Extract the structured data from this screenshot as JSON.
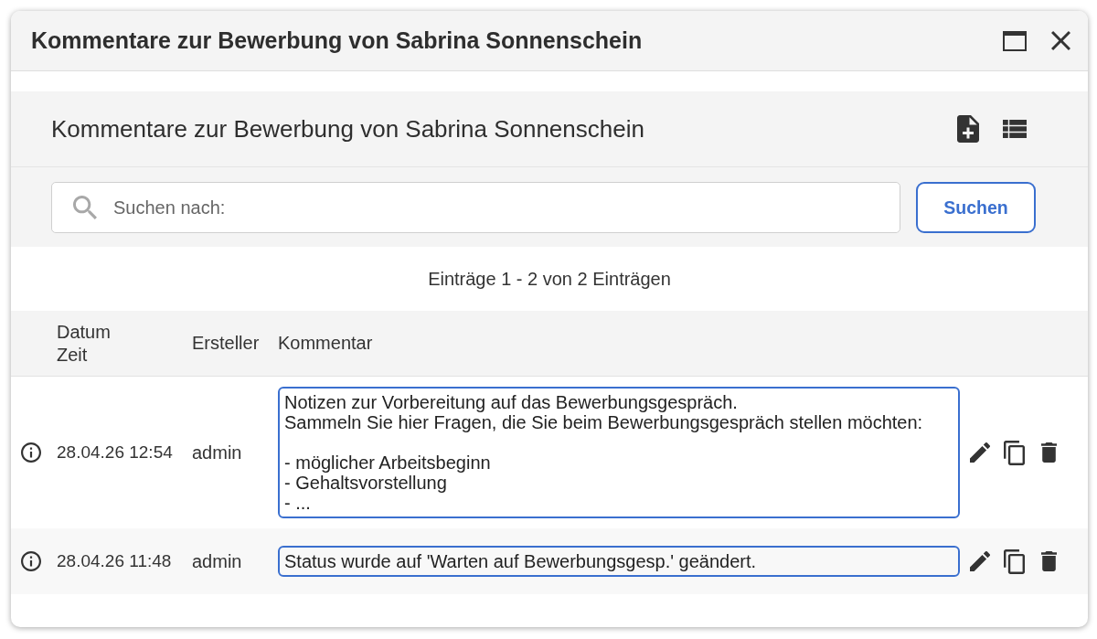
{
  "window": {
    "title": "Kommentare zur Bewerbung von Sabrina Sonnenschein"
  },
  "panel": {
    "title": "Kommentare zur Bewerbung von Sabrina Sonnenschein"
  },
  "search": {
    "placeholder": "Suchen nach:",
    "button": "Suchen"
  },
  "entry_count": "Einträge 1 - 2 von 2 Einträgen",
  "table": {
    "columns": [
      "Datum\nZeit",
      "Ersteller",
      "Kommentar"
    ],
    "rows": [
      {
        "datetime": "28.04.26 12:54",
        "author": "admin",
        "comment": "Notizen zur Vorbereitung auf das Bewerbungsgespräch.\nSammeln Sie hier Fragen, die Sie beim Bewerbungsgespräch stellen möchten:\n\n- möglicher Arbeitsbeginn\n- Gehaltsvorstellung\n- ..."
      },
      {
        "datetime": "28.04.26 11:48",
        "author": "admin",
        "comment": "Status wurde auf 'Warten auf Bewerbungsgesp.' geändert."
      }
    ]
  }
}
